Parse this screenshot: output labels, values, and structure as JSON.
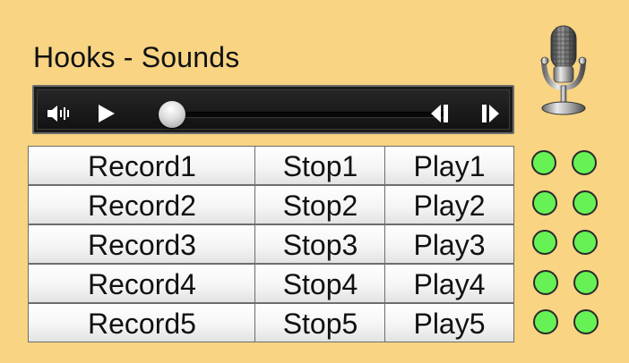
{
  "title": "Hooks - Sounds",
  "player": {
    "volume_icon": "volume-icon",
    "play_icon": "play-icon",
    "progress": 0.0,
    "rewind_icon": "skip-back-icon",
    "forward_icon": "skip-forward-icon"
  },
  "mic_icon": "microphone-icon",
  "rows": [
    {
      "record": "Record1",
      "stop": "Stop1",
      "play": "Play1"
    },
    {
      "record": "Record2",
      "stop": "Stop2",
      "play": "Play2"
    },
    {
      "record": "Record3",
      "stop": "Stop3",
      "play": "Play3"
    },
    {
      "record": "Record4",
      "stop": "Stop4",
      "play": "Play4"
    },
    {
      "record": "Record5",
      "stop": "Stop5",
      "play": "Play5"
    }
  ],
  "colors": {
    "background": "#f8d483",
    "indicator": "#66f255"
  }
}
